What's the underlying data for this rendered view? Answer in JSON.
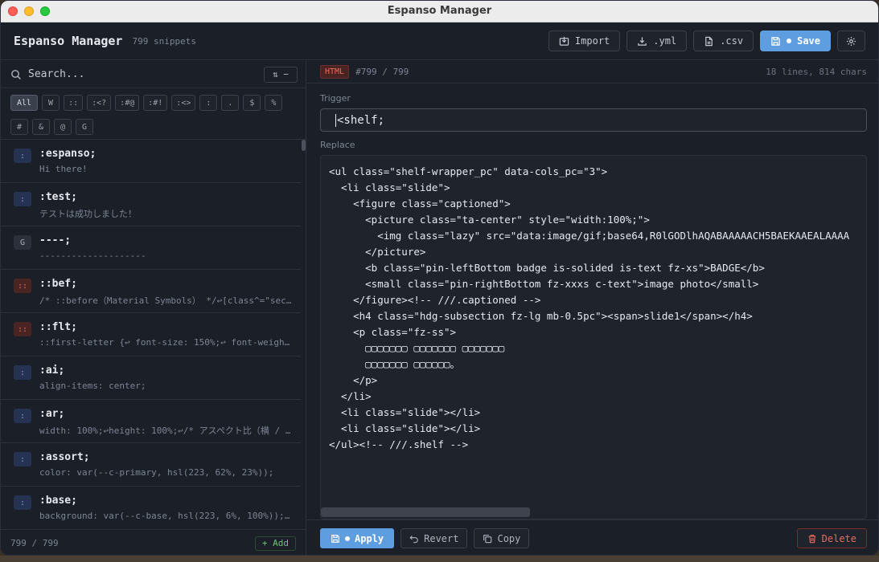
{
  "window": {
    "title": "Espanso Manager"
  },
  "header": {
    "app_name": "Espanso Manager",
    "snippet_count": "799 snippets",
    "import_label": "Import",
    "yml_label": ".yml",
    "csv_label": ".csv",
    "save_label": "Save"
  },
  "search": {
    "placeholder": "Search...",
    "sort_label": "⇅ −"
  },
  "filters": [
    "All",
    "W",
    "::",
    ":<?",
    ":#@",
    ":#!",
    ":<>",
    ":",
    ".",
    "$",
    "%",
    "#",
    "&",
    "@",
    "G"
  ],
  "snippets": [
    {
      "badge": ":",
      "type": "colon",
      "trigger": ":espanso;",
      "preview": "Hi there!"
    },
    {
      "badge": ":",
      "type": "colon",
      "trigger": ":test;",
      "preview": "テストは成功しました！"
    },
    {
      "badge": "G",
      "type": "g",
      "trigger": "----;",
      "preview": "--------------------"
    },
    {
      "badge": "::",
      "type": "dcolon",
      "trigger": "::bef;",
      "preview": "/* ::before（Material Symbols） */↩[class^=\"sec…"
    },
    {
      "badge": "::",
      "type": "dcolon",
      "trigger": "::flt;",
      "preview": "::first-letter {↩ font-size: 150%;↩ font-weigh…"
    },
    {
      "badge": ":",
      "type": "colon",
      "trigger": ":ai;",
      "preview": "align-items: center;"
    },
    {
      "badge": ":",
      "type": "colon",
      "trigger": ":ar;",
      "preview": "width: 100%;↩height: 100%;↩/* アスペクト比（横 / …"
    },
    {
      "badge": ":",
      "type": "colon",
      "trigger": ":assort;",
      "preview": "color: var(--c-primary, hsl(223, 62%, 23%));"
    },
    {
      "badge": ":",
      "type": "colon",
      "trigger": ":base;",
      "preview": "background: var(--c-base, hsl(223, 6%, 100%));…"
    }
  ],
  "list_footer": {
    "count": "799 / 799",
    "add_label": "+ Add"
  },
  "editor": {
    "lang_tag": "HTML",
    "id": "#799 / 799",
    "meta": "18 lines, 814 chars",
    "trigger_label": "Trigger",
    "trigger_value": "<shelf;",
    "replace_label": "Replace",
    "code": "<ul class=\"shelf-wrapper_pc\" data-cols_pc=\"3\">\n  <li class=\"slide\">\n    <figure class=\"captioned\">\n      <picture class=\"ta-center\" style=\"width:100%;\">\n        <img class=\"lazy\" src=\"data:image/gif;base64,R0lGODlhAQABAAAAACH5BAEKAAEALAAAA\n      </picture>\n      <b class=\"pin-leftBottom badge is-solided is-text fz-xs\">BADGE</b>\n      <small class=\"pin-rightBottom fz-xxxs c-text\">image photo</small>\n    </figure><!-- ///.captioned -->\n    <h4 class=\"hdg-subsection fz-lg mb-0.5pc\"><span>slide1</span></h4>\n    <p class=\"fz-ss\">\n      ▢▢▢▢▢▢▢ ▢▢▢▢▢▢▢ ▢▢▢▢▢▢▢\n      ▢▢▢▢▢▢▢ ▢▢▢▢▢▢。\n    </p>\n  </li>\n  <li class=\"slide\"></li>\n  <li class=\"slide\"></li>\n</ul><!-- ///.shelf -->",
    "apply_label": "Apply",
    "revert_label": "Revert",
    "copy_label": "Copy",
    "delete_label": "Delete"
  }
}
